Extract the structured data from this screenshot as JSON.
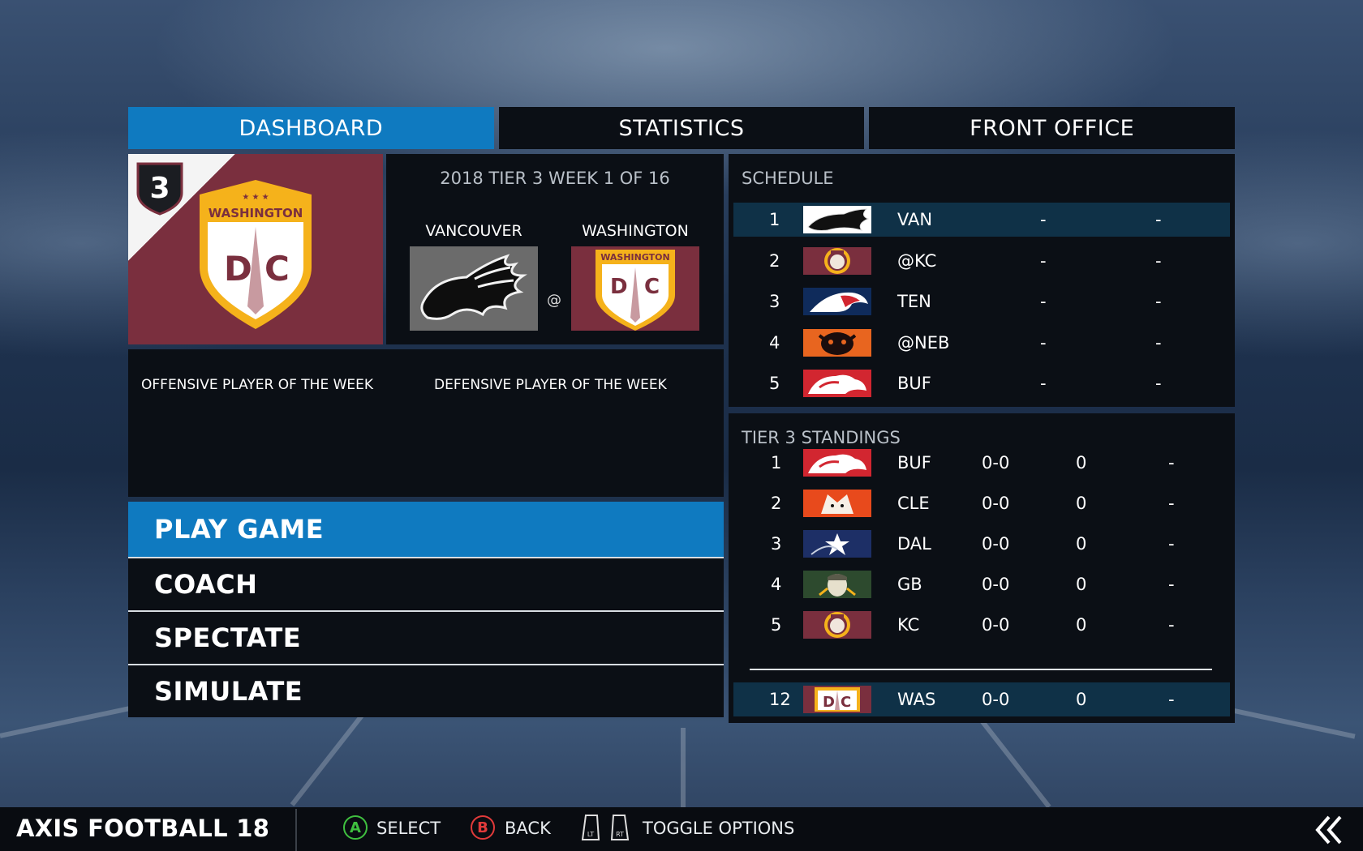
{
  "tabs": [
    {
      "label": "DASHBOARD",
      "active": true
    },
    {
      "label": "STATISTICS",
      "active": false
    },
    {
      "label": "FRONT OFFICE",
      "active": false
    }
  ],
  "team": {
    "rank": "3",
    "logo_text": "WASHINGTON",
    "logo_letters": "D C",
    "primary_color": "#7a2f3e",
    "accent_color": "#f5b21b"
  },
  "matchup": {
    "title": "2018 TIER 3 WEEK 1 OF 16",
    "away": "VANCOUVER",
    "home": "WASHINGTON",
    "at_symbol": "@"
  },
  "player_of_week": {
    "offensive": "OFFENSIVE PLAYER OF THE WEEK",
    "defensive": "DEFENSIVE PLAYER OF THE WEEK"
  },
  "menu": [
    {
      "label": "PLAY GAME",
      "selected": true
    },
    {
      "label": "COACH",
      "selected": false
    },
    {
      "label": "SPECTATE",
      "selected": false
    },
    {
      "label": "SIMULATE",
      "selected": false
    }
  ],
  "schedule": {
    "title": "SCHEDULE",
    "rows": [
      {
        "week": "1",
        "opponent": "VAN",
        "result": "-",
        "score": "-",
        "logo": "vancouver-logo"
      },
      {
        "week": "2",
        "opponent": "@KC",
        "result": "-",
        "score": "-",
        "logo": "kansas-city-logo"
      },
      {
        "week": "3",
        "opponent": "TEN",
        "result": "-",
        "score": "-",
        "logo": "tennessee-logo"
      },
      {
        "week": "4",
        "opponent": "@NEB",
        "result": "-",
        "score": "-",
        "logo": "nebraska-logo"
      },
      {
        "week": "5",
        "opponent": "BUF",
        "result": "-",
        "score": "-",
        "logo": "buffalo-logo"
      }
    ]
  },
  "standings": {
    "title": "TIER 3 STANDINGS",
    "rows": [
      {
        "rank": "1",
        "team": "BUF",
        "record": "0-0",
        "pts": "0",
        "streak": "-",
        "logo": "buffalo-logo"
      },
      {
        "rank": "2",
        "team": "CLE",
        "record": "0-0",
        "pts": "0",
        "streak": "-",
        "logo": "cleveland-logo"
      },
      {
        "rank": "3",
        "team": "DAL",
        "record": "0-0",
        "pts": "0",
        "streak": "-",
        "logo": "dallas-logo"
      },
      {
        "rank": "4",
        "team": "GB",
        "record": "0-0",
        "pts": "0",
        "streak": "-",
        "logo": "green-bay-logo"
      },
      {
        "rank": "5",
        "team": "KC",
        "record": "0-0",
        "pts": "0",
        "streak": "-",
        "logo": "kansas-city-logo"
      }
    ],
    "own": {
      "rank": "12",
      "team": "WAS",
      "record": "0-0",
      "pts": "0",
      "streak": "-",
      "logo": "washington-logo"
    }
  },
  "bottom_bar": {
    "brand": "AXIS FOOTBALL 18",
    "select_btn": "A",
    "select_label": "SELECT",
    "back_btn": "B",
    "back_label": "BACK",
    "lt": "LT",
    "rt": "RT",
    "toggle_label": "TOGGLE OPTIONS",
    "select_color": "#3fbf3f",
    "back_color": "#e03a3a"
  }
}
